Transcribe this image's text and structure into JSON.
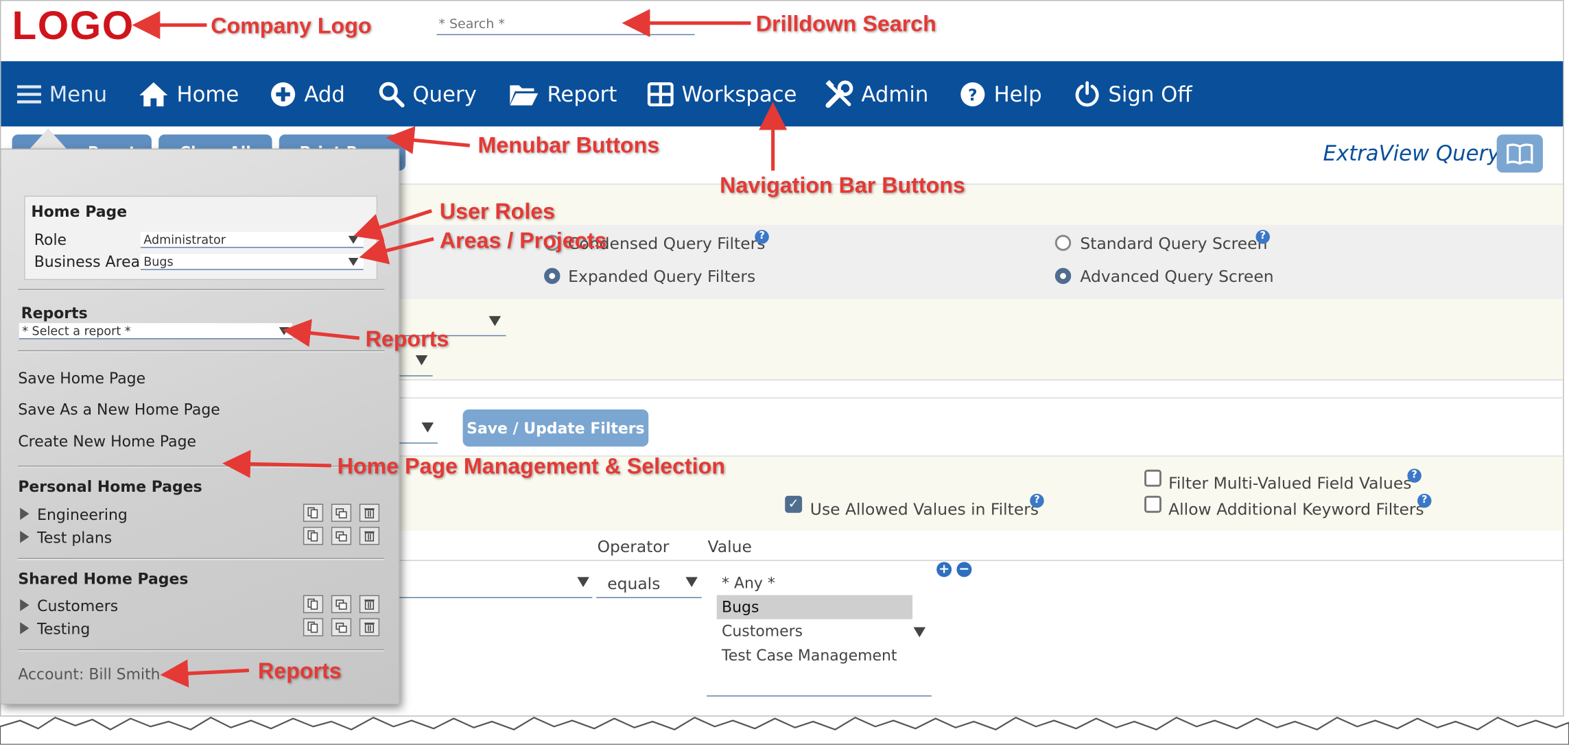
{
  "header": {
    "logo_text": "LOGO",
    "search_placeholder": "* Search *"
  },
  "navbar": {
    "items": [
      {
        "label": "Menu"
      },
      {
        "label": "Home"
      },
      {
        "label": "Add"
      },
      {
        "label": "Query"
      },
      {
        "label": "Report"
      },
      {
        "label": "Workspace"
      },
      {
        "label": "Admin"
      },
      {
        "label": "Help"
      },
      {
        "label": "Sign Off"
      }
    ]
  },
  "toolbar": {
    "buttons": [
      "Reset",
      "Clear All",
      "Print Re..."
    ]
  },
  "query_page": {
    "title": "ExtraView Query",
    "radio_options": [
      {
        "label": "Condensed Query Filters",
        "selected": false
      },
      {
        "label": "Expanded Query Filters",
        "selected": true
      },
      {
        "label": "Standard Query Screen",
        "selected": false
      },
      {
        "label": "Advanced Query Screen",
        "selected": true
      }
    ],
    "save_filters_label": "Save / Update Filters",
    "checkboxes": [
      {
        "label": "Filter Multi-Valued Field Values",
        "checked": false
      },
      {
        "label": "Use Allowed Values in Filters",
        "checked": true
      },
      {
        "label": "Allow Additional Keyword Filters",
        "checked": false
      }
    ],
    "columns": {
      "operator": "Operator",
      "value": "Value"
    },
    "operator_value": "equals",
    "value_options": [
      "* Any *",
      "Bugs",
      "Customers",
      "Test Case Management"
    ],
    "value_selected": "Bugs"
  },
  "menu_panel": {
    "home_page_title": "Home Page",
    "role_label": "Role",
    "role_value": "Administrator",
    "area_label": "Business Area",
    "area_value": "Bugs",
    "reports_title": "Reports",
    "report_select": "* Select a report *",
    "actions": [
      "Save Home Page",
      "Save As a New Home Page",
      "Create New Home Page"
    ],
    "personal_title": "Personal Home Pages",
    "personal_pages": [
      "Engineering",
      "Test plans"
    ],
    "shared_title": "Shared Home Pages",
    "shared_pages": [
      "Customers",
      "Testing"
    ],
    "account": "Account: Bill Smith"
  },
  "annotations": {
    "company_logo": "Company Logo",
    "drilldown_search": "Drilldown Search",
    "menubar_buttons": "Menubar Buttons",
    "navigation_bar_buttons": "Navigation Bar Buttons",
    "user_roles": "User Roles",
    "areas_projects": "Areas / Projects",
    "reports_1": "Reports",
    "home_page_mgmt": "Home Page Management & Selection",
    "reports_2": "Reports"
  },
  "colors": {
    "navbar": "#0a4f9a",
    "logo": "#d0141c",
    "annotation": "#e53935",
    "button": "#5e8fc0"
  }
}
